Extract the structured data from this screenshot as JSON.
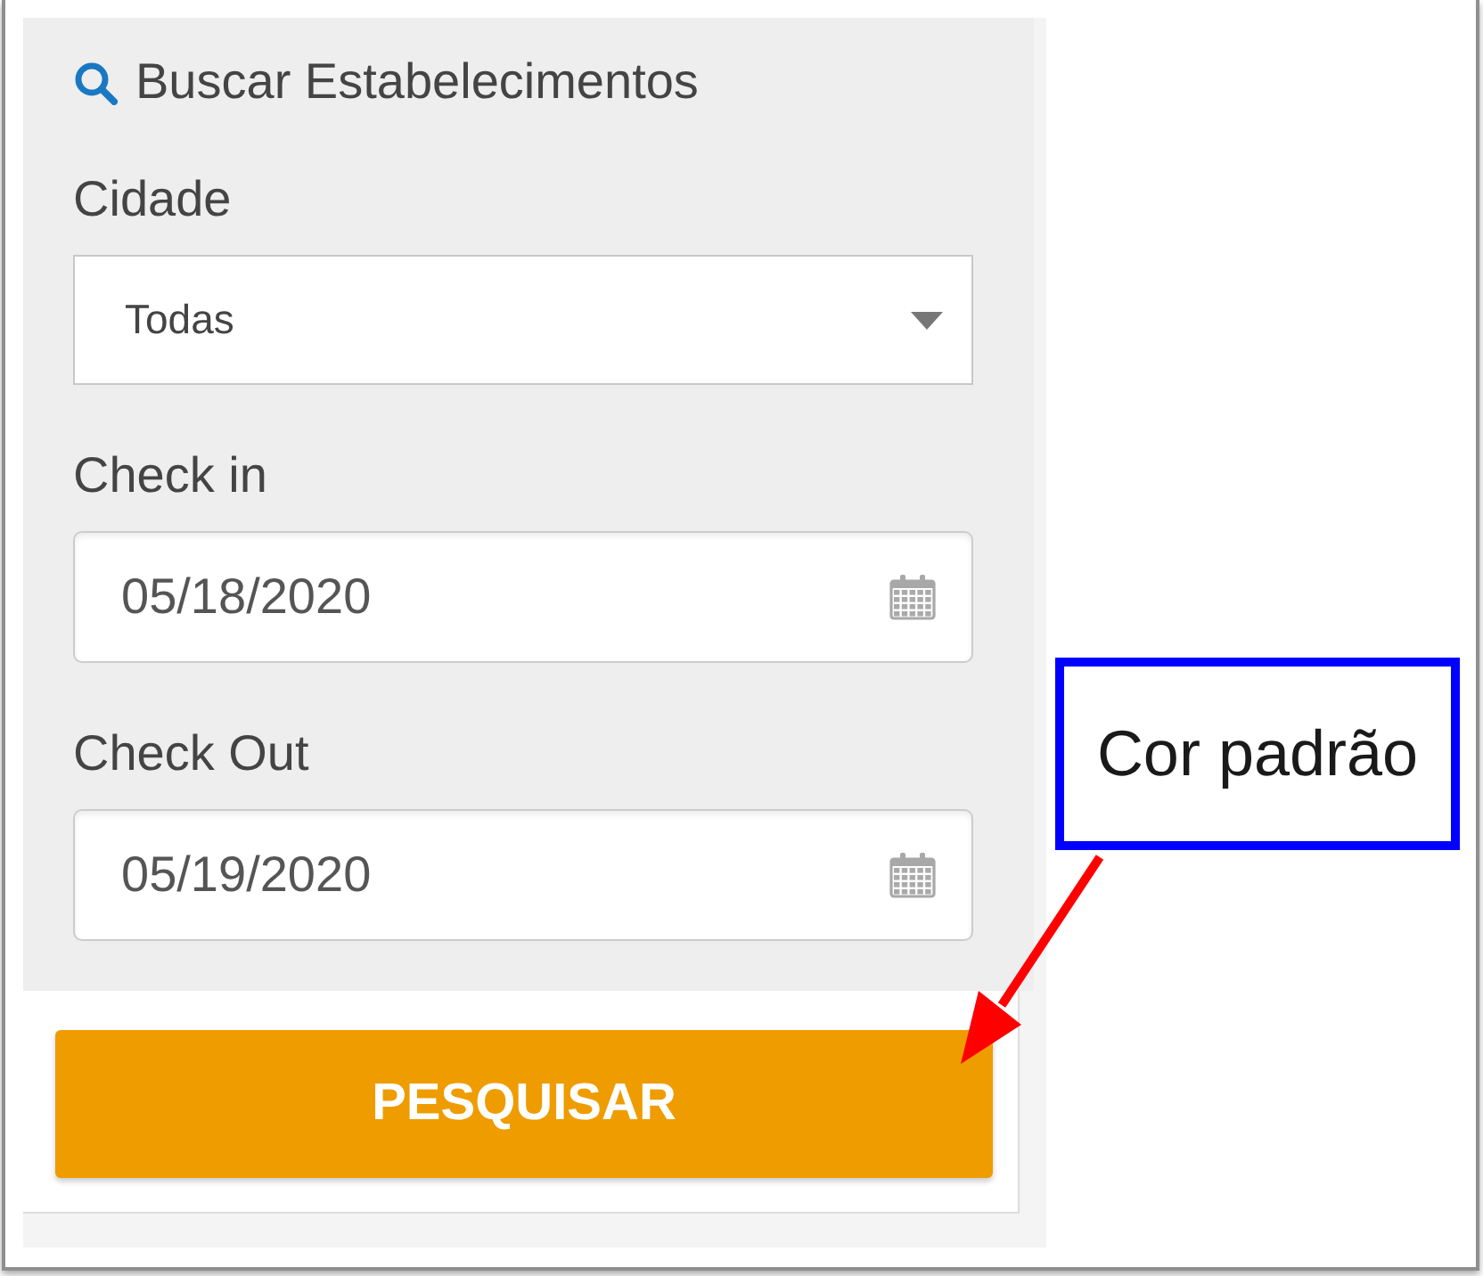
{
  "search_panel": {
    "title": "Buscar Estabelecimentos",
    "fields": [
      {
        "kind": "select",
        "label": "Cidade",
        "value": "Todas"
      },
      {
        "kind": "date",
        "label": "Check in",
        "value": "05/18/2020"
      },
      {
        "kind": "date",
        "label": "Check Out",
        "value": "05/19/2020"
      }
    ]
  },
  "search_button": {
    "label": "PESQUISAR"
  },
  "annotation": {
    "text": "Cor padrão"
  }
}
